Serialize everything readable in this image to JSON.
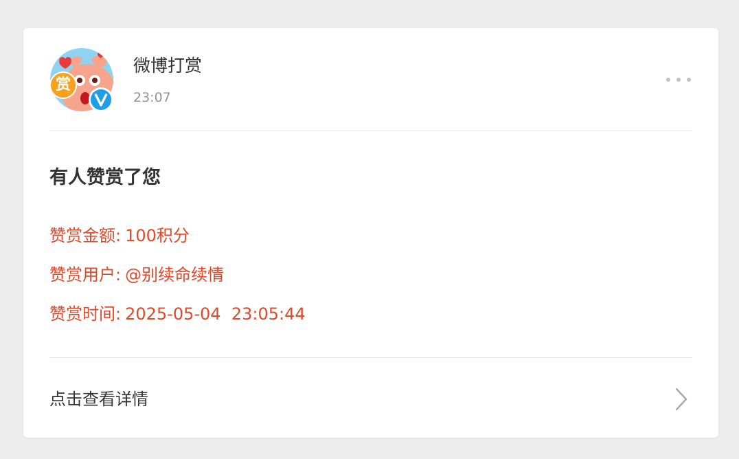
{
  "header": {
    "username": "微博打赏",
    "time": "23:07",
    "avatar_badge_text": "赏",
    "verified_icon": "verified-v-icon",
    "more_icon": "more-dots-icon"
  },
  "notification": {
    "title": "有人赞赏了您",
    "lines": [
      {
        "label": "赞赏金额:",
        "value": "100积分"
      },
      {
        "label": "赞赏用户:",
        "value": "@别续命续情"
      },
      {
        "label": "赞赏时间:",
        "value": "2025-05-04  23:05:44"
      }
    ]
  },
  "footer": {
    "detail_label": "点击查看详情",
    "chevron_icon": "chevron-right-icon"
  },
  "colors": {
    "background": "#ededed",
    "card": "#ffffff",
    "accent_red": "#e2492b",
    "verified_blue": "#1e9ee8",
    "text_primary": "#333333",
    "text_secondary": "#939393"
  }
}
